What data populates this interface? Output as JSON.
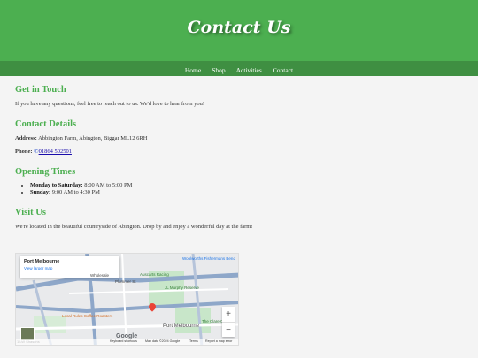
{
  "header": {
    "title": "Contact Us"
  },
  "nav": {
    "items": [
      "Home",
      "Shop",
      "Activities",
      "Contact"
    ]
  },
  "touch": {
    "heading": "Get in Touch",
    "text": "If you have any questions, feel free to reach out to us. We'd love to hear from you!"
  },
  "details": {
    "heading": "Contact Details",
    "address_label": "Address:",
    "address": "Abbington Farm, Abington, Biggar ML12 6RH",
    "phone_label": "Phone:",
    "phone": "01864 502501"
  },
  "hours": {
    "heading": "Opening Times",
    "items": [
      {
        "days": "Monday to Saturday:",
        "time": "8:00 AM to 5:00 PM"
      },
      {
        "days": "Sunday:",
        "time": "9:00 AM to 4:30 PM"
      }
    ]
  },
  "visit": {
    "heading": "Visit Us",
    "text": "We're located in the beautiful countryside of Abington. Drop by and enjoy a wonderful day at the farm!"
  },
  "map": {
    "place": "Port Melbourne",
    "link": "View larger map",
    "labels": {
      "woolworths": "Woolworths Fishermans Bend",
      "auscarts": "Auscarts Racing",
      "jl_murphy": "JL Murphy Reserve",
      "plummer": "Plummer St",
      "wholesale": "Wholesale",
      "local_rules": "Local Rules Coffee Roasters",
      "port_melbourne": "Port Melbourne",
      "clare": "The Clare Ca",
      "zoom_in": "+",
      "zoom_out": "−",
      "google": "Google",
      "keyboard": "Keyboard shortcuts",
      "mapdata": "Map data ©2024 Google",
      "terms": "Terms",
      "report": "Report a map error",
      "street_view": "1 LW Shasons"
    }
  }
}
